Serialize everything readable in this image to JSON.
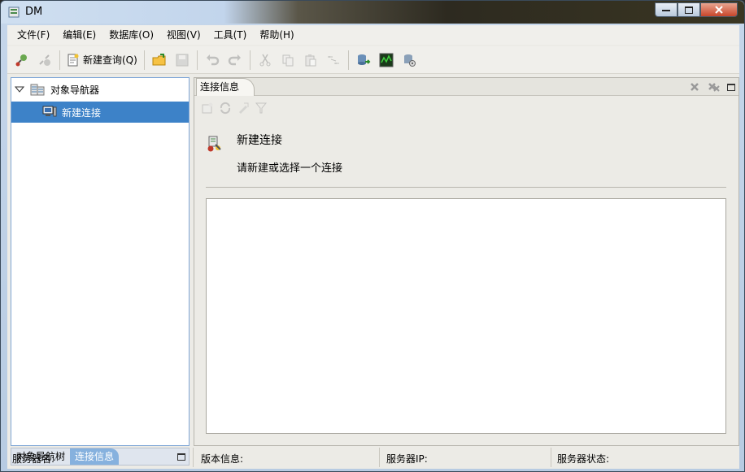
{
  "window": {
    "title": "DM"
  },
  "menu": [
    {
      "label": "文件(F)"
    },
    {
      "label": "编辑(E)"
    },
    {
      "label": "数据库(O)"
    },
    {
      "label": "视图(V)"
    },
    {
      "label": "工具(T)"
    },
    {
      "label": "帮助(H)"
    }
  ],
  "toolbar": {
    "new_query_label": "新建查询(Q)",
    "icons": [
      "connect-icon",
      "disconnect-icon",
      "new-query-icon",
      "open-icon",
      "save-icon",
      "undo-icon",
      "redo-icon",
      "cut-icon",
      "copy-icon",
      "paste-icon",
      "dm-convert-icon",
      "db-export-icon",
      "monitor-icon",
      "db-settings-icon"
    ]
  },
  "navigator": {
    "root_label": "对象导航器",
    "child_label": "新建连接",
    "tabs": [
      {
        "label": "对象导航树"
      },
      {
        "label": "连接信息"
      }
    ]
  },
  "editor": {
    "tab_label": "连接信息",
    "title": "新建连接",
    "subtitle": "请新建或选择一个连接"
  },
  "status": {
    "server_name": "服务器名:",
    "version": "版本信息:",
    "server_ip": "服务器IP:",
    "server_status": "服务器状态:"
  },
  "colors": {
    "selection": "#3d82c8",
    "active_tab": "#86b1de",
    "frame": "#c5d6ea"
  }
}
